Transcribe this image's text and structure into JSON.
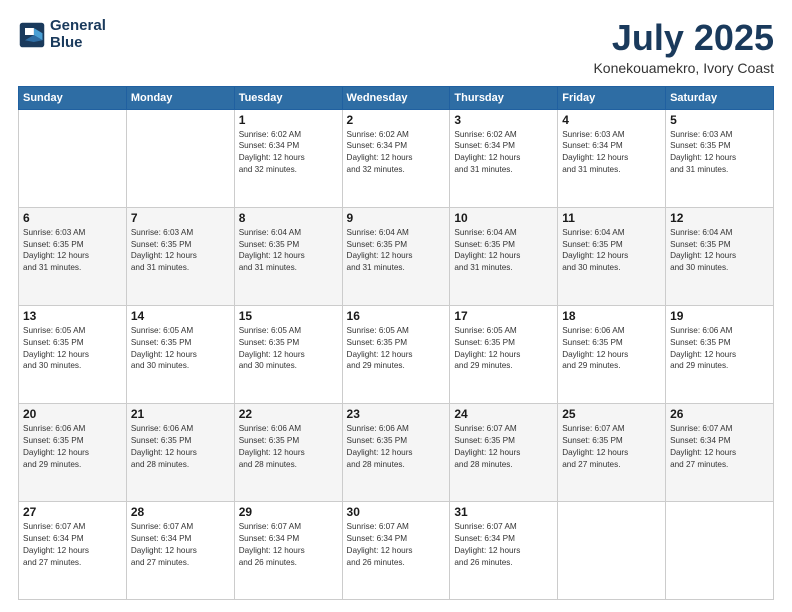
{
  "header": {
    "logo_line1": "General",
    "logo_line2": "Blue",
    "title": "July 2025",
    "subtitle": "Konekouamekro, Ivory Coast"
  },
  "weekdays": [
    "Sunday",
    "Monday",
    "Tuesday",
    "Wednesday",
    "Thursday",
    "Friday",
    "Saturday"
  ],
  "weeks": [
    [
      {
        "day": "",
        "info": ""
      },
      {
        "day": "",
        "info": ""
      },
      {
        "day": "1",
        "info": "Sunrise: 6:02 AM\nSunset: 6:34 PM\nDaylight: 12 hours\nand 32 minutes."
      },
      {
        "day": "2",
        "info": "Sunrise: 6:02 AM\nSunset: 6:34 PM\nDaylight: 12 hours\nand 32 minutes."
      },
      {
        "day": "3",
        "info": "Sunrise: 6:02 AM\nSunset: 6:34 PM\nDaylight: 12 hours\nand 31 minutes."
      },
      {
        "day": "4",
        "info": "Sunrise: 6:03 AM\nSunset: 6:34 PM\nDaylight: 12 hours\nand 31 minutes."
      },
      {
        "day": "5",
        "info": "Sunrise: 6:03 AM\nSunset: 6:35 PM\nDaylight: 12 hours\nand 31 minutes."
      }
    ],
    [
      {
        "day": "6",
        "info": "Sunrise: 6:03 AM\nSunset: 6:35 PM\nDaylight: 12 hours\nand 31 minutes."
      },
      {
        "day": "7",
        "info": "Sunrise: 6:03 AM\nSunset: 6:35 PM\nDaylight: 12 hours\nand 31 minutes."
      },
      {
        "day": "8",
        "info": "Sunrise: 6:04 AM\nSunset: 6:35 PM\nDaylight: 12 hours\nand 31 minutes."
      },
      {
        "day": "9",
        "info": "Sunrise: 6:04 AM\nSunset: 6:35 PM\nDaylight: 12 hours\nand 31 minutes."
      },
      {
        "day": "10",
        "info": "Sunrise: 6:04 AM\nSunset: 6:35 PM\nDaylight: 12 hours\nand 31 minutes."
      },
      {
        "day": "11",
        "info": "Sunrise: 6:04 AM\nSunset: 6:35 PM\nDaylight: 12 hours\nand 30 minutes."
      },
      {
        "day": "12",
        "info": "Sunrise: 6:04 AM\nSunset: 6:35 PM\nDaylight: 12 hours\nand 30 minutes."
      }
    ],
    [
      {
        "day": "13",
        "info": "Sunrise: 6:05 AM\nSunset: 6:35 PM\nDaylight: 12 hours\nand 30 minutes."
      },
      {
        "day": "14",
        "info": "Sunrise: 6:05 AM\nSunset: 6:35 PM\nDaylight: 12 hours\nand 30 minutes."
      },
      {
        "day": "15",
        "info": "Sunrise: 6:05 AM\nSunset: 6:35 PM\nDaylight: 12 hours\nand 30 minutes."
      },
      {
        "day": "16",
        "info": "Sunrise: 6:05 AM\nSunset: 6:35 PM\nDaylight: 12 hours\nand 29 minutes."
      },
      {
        "day": "17",
        "info": "Sunrise: 6:05 AM\nSunset: 6:35 PM\nDaylight: 12 hours\nand 29 minutes."
      },
      {
        "day": "18",
        "info": "Sunrise: 6:06 AM\nSunset: 6:35 PM\nDaylight: 12 hours\nand 29 minutes."
      },
      {
        "day": "19",
        "info": "Sunrise: 6:06 AM\nSunset: 6:35 PM\nDaylight: 12 hours\nand 29 minutes."
      }
    ],
    [
      {
        "day": "20",
        "info": "Sunrise: 6:06 AM\nSunset: 6:35 PM\nDaylight: 12 hours\nand 29 minutes."
      },
      {
        "day": "21",
        "info": "Sunrise: 6:06 AM\nSunset: 6:35 PM\nDaylight: 12 hours\nand 28 minutes."
      },
      {
        "day": "22",
        "info": "Sunrise: 6:06 AM\nSunset: 6:35 PM\nDaylight: 12 hours\nand 28 minutes."
      },
      {
        "day": "23",
        "info": "Sunrise: 6:06 AM\nSunset: 6:35 PM\nDaylight: 12 hours\nand 28 minutes."
      },
      {
        "day": "24",
        "info": "Sunrise: 6:07 AM\nSunset: 6:35 PM\nDaylight: 12 hours\nand 28 minutes."
      },
      {
        "day": "25",
        "info": "Sunrise: 6:07 AM\nSunset: 6:35 PM\nDaylight: 12 hours\nand 27 minutes."
      },
      {
        "day": "26",
        "info": "Sunrise: 6:07 AM\nSunset: 6:34 PM\nDaylight: 12 hours\nand 27 minutes."
      }
    ],
    [
      {
        "day": "27",
        "info": "Sunrise: 6:07 AM\nSunset: 6:34 PM\nDaylight: 12 hours\nand 27 minutes."
      },
      {
        "day": "28",
        "info": "Sunrise: 6:07 AM\nSunset: 6:34 PM\nDaylight: 12 hours\nand 27 minutes."
      },
      {
        "day": "29",
        "info": "Sunrise: 6:07 AM\nSunset: 6:34 PM\nDaylight: 12 hours\nand 26 minutes."
      },
      {
        "day": "30",
        "info": "Sunrise: 6:07 AM\nSunset: 6:34 PM\nDaylight: 12 hours\nand 26 minutes."
      },
      {
        "day": "31",
        "info": "Sunrise: 6:07 AM\nSunset: 6:34 PM\nDaylight: 12 hours\nand 26 minutes."
      },
      {
        "day": "",
        "info": ""
      },
      {
        "day": "",
        "info": ""
      }
    ]
  ]
}
